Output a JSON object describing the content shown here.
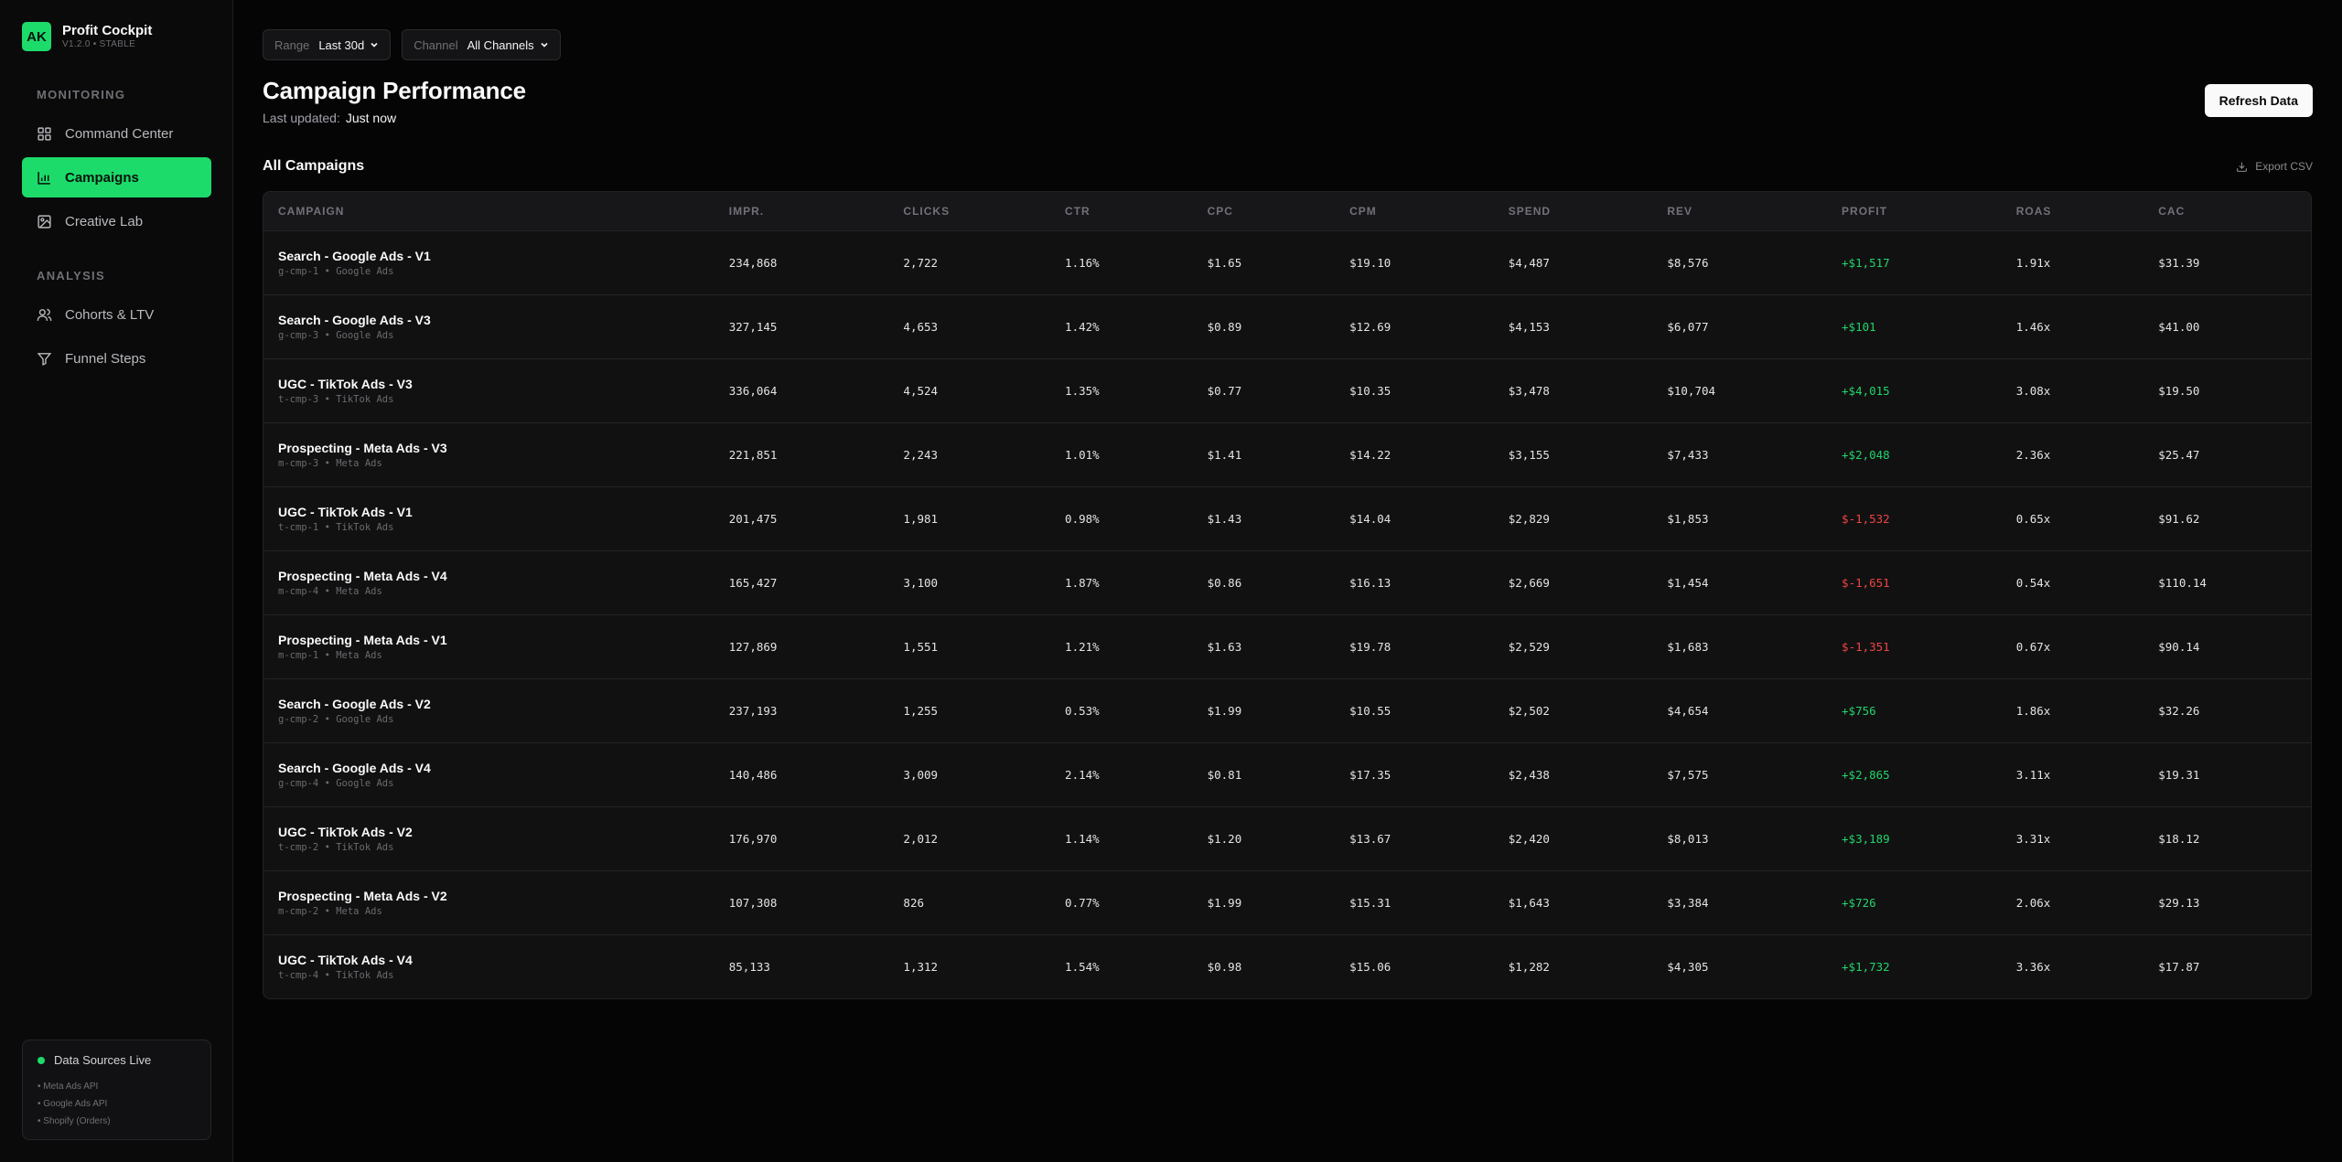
{
  "sidebar": {
    "brand": {
      "initials": "AK",
      "name": "Profit Cockpit",
      "version": "V1.2.0 • STABLE"
    },
    "sections": [
      {
        "heading": "MONITORING",
        "items": [
          {
            "label": "Command Center",
            "icon": "grid-icon"
          },
          {
            "label": "Campaigns",
            "icon": "bar-chart-icon",
            "active": true
          },
          {
            "label": "Creative Lab",
            "icon": "image-icon"
          }
        ]
      },
      {
        "heading": "ANALYSIS",
        "items": [
          {
            "label": "Cohorts & LTV",
            "icon": "users-icon"
          },
          {
            "label": "Funnel Steps",
            "icon": "filter-icon"
          }
        ]
      }
    ],
    "data_sources": {
      "title": "Data Sources Live",
      "items": [
        "• Meta Ads API",
        "• Google Ads API",
        "• Shopify (Orders)"
      ]
    }
  },
  "filters": {
    "range": {
      "label": "Range",
      "value": "Last 30d"
    },
    "channel": {
      "label": "Channel",
      "value": "All Channels"
    }
  },
  "header": {
    "title": "Campaign Performance",
    "updated_label": "Last updated:",
    "updated_value": "Just now",
    "refresh_label": "Refresh Data"
  },
  "table": {
    "title": "All Campaigns",
    "export_label": "Export CSV",
    "columns": [
      "CAMPAIGN",
      "IMPR.",
      "CLICKS",
      "CTR",
      "CPC",
      "CPM",
      "SPEND",
      "REV",
      "PROFIT",
      "ROAS",
      "CAC"
    ],
    "rows": [
      {
        "name": "Search - Google Ads - V1",
        "sub": "g-cmp-1 • Google Ads",
        "impr": "234,868",
        "clicks": "2,722",
        "ctr": "1.16%",
        "cpc": "$1.65",
        "cpm": "$19.10",
        "spend": "$4,487",
        "rev": "$8,576",
        "profit": "+$1,517",
        "roas": "1.91x",
        "cac": "$31.39"
      },
      {
        "name": "Search - Google Ads - V3",
        "sub": "g-cmp-3 • Google Ads",
        "impr": "327,145",
        "clicks": "4,653",
        "ctr": "1.42%",
        "cpc": "$0.89",
        "cpm": "$12.69",
        "spend": "$4,153",
        "rev": "$6,077",
        "profit": "+$101",
        "roas": "1.46x",
        "cac": "$41.00"
      },
      {
        "name": "UGC - TikTok Ads - V3",
        "sub": "t-cmp-3 • TikTok Ads",
        "impr": "336,064",
        "clicks": "4,524",
        "ctr": "1.35%",
        "cpc": "$0.77",
        "cpm": "$10.35",
        "spend": "$3,478",
        "rev": "$10,704",
        "profit": "+$4,015",
        "roas": "3.08x",
        "cac": "$19.50"
      },
      {
        "name": "Prospecting - Meta Ads - V3",
        "sub": "m-cmp-3 • Meta Ads",
        "impr": "221,851",
        "clicks": "2,243",
        "ctr": "1.01%",
        "cpc": "$1.41",
        "cpm": "$14.22",
        "spend": "$3,155",
        "rev": "$7,433",
        "profit": "+$2,048",
        "roas": "2.36x",
        "cac": "$25.47"
      },
      {
        "name": "UGC - TikTok Ads - V1",
        "sub": "t-cmp-1 • TikTok Ads",
        "impr": "201,475",
        "clicks": "1,981",
        "ctr": "0.98%",
        "cpc": "$1.43",
        "cpm": "$14.04",
        "spend": "$2,829",
        "rev": "$1,853",
        "profit": "$-1,532",
        "roas": "0.65x",
        "cac": "$91.62"
      },
      {
        "name": "Prospecting - Meta Ads - V4",
        "sub": "m-cmp-4 • Meta Ads",
        "impr": "165,427",
        "clicks": "3,100",
        "ctr": "1.87%",
        "cpc": "$0.86",
        "cpm": "$16.13",
        "spend": "$2,669",
        "rev": "$1,454",
        "profit": "$-1,651",
        "roas": "0.54x",
        "cac": "$110.14"
      },
      {
        "name": "Prospecting - Meta Ads - V1",
        "sub": "m-cmp-1 • Meta Ads",
        "impr": "127,869",
        "clicks": "1,551",
        "ctr": "1.21%",
        "cpc": "$1.63",
        "cpm": "$19.78",
        "spend": "$2,529",
        "rev": "$1,683",
        "profit": "$-1,351",
        "roas": "0.67x",
        "cac": "$90.14"
      },
      {
        "name": "Search - Google Ads - V2",
        "sub": "g-cmp-2 • Google Ads",
        "impr": "237,193",
        "clicks": "1,255",
        "ctr": "0.53%",
        "cpc": "$1.99",
        "cpm": "$10.55",
        "spend": "$2,502",
        "rev": "$4,654",
        "profit": "+$756",
        "roas": "1.86x",
        "cac": "$32.26"
      },
      {
        "name": "Search - Google Ads - V4",
        "sub": "g-cmp-4 • Google Ads",
        "impr": "140,486",
        "clicks": "3,009",
        "ctr": "2.14%",
        "cpc": "$0.81",
        "cpm": "$17.35",
        "spend": "$2,438",
        "rev": "$7,575",
        "profit": "+$2,865",
        "roas": "3.11x",
        "cac": "$19.31"
      },
      {
        "name": "UGC - TikTok Ads - V2",
        "sub": "t-cmp-2 • TikTok Ads",
        "impr": "176,970",
        "clicks": "2,012",
        "ctr": "1.14%",
        "cpc": "$1.20",
        "cpm": "$13.67",
        "spend": "$2,420",
        "rev": "$8,013",
        "profit": "+$3,189",
        "roas": "3.31x",
        "cac": "$18.12"
      },
      {
        "name": "Prospecting - Meta Ads - V2",
        "sub": "m-cmp-2 • Meta Ads",
        "impr": "107,308",
        "clicks": "826",
        "ctr": "0.77%",
        "cpc": "$1.99",
        "cpm": "$15.31",
        "spend": "$1,643",
        "rev": "$3,384",
        "profit": "+$726",
        "roas": "2.06x",
        "cac": "$29.13"
      },
      {
        "name": "UGC - TikTok Ads - V4",
        "sub": "t-cmp-4 • TikTok Ads",
        "impr": "85,133",
        "clicks": "1,312",
        "ctr": "1.54%",
        "cpc": "$0.98",
        "cpm": "$15.06",
        "spend": "$1,282",
        "rev": "$4,305",
        "profit": "+$1,732",
        "roas": "3.36x",
        "cac": "$17.87"
      }
    ]
  },
  "colors": {
    "accent": "#1ddb6b",
    "positive": "#22d46a",
    "negative": "#ef4444"
  }
}
